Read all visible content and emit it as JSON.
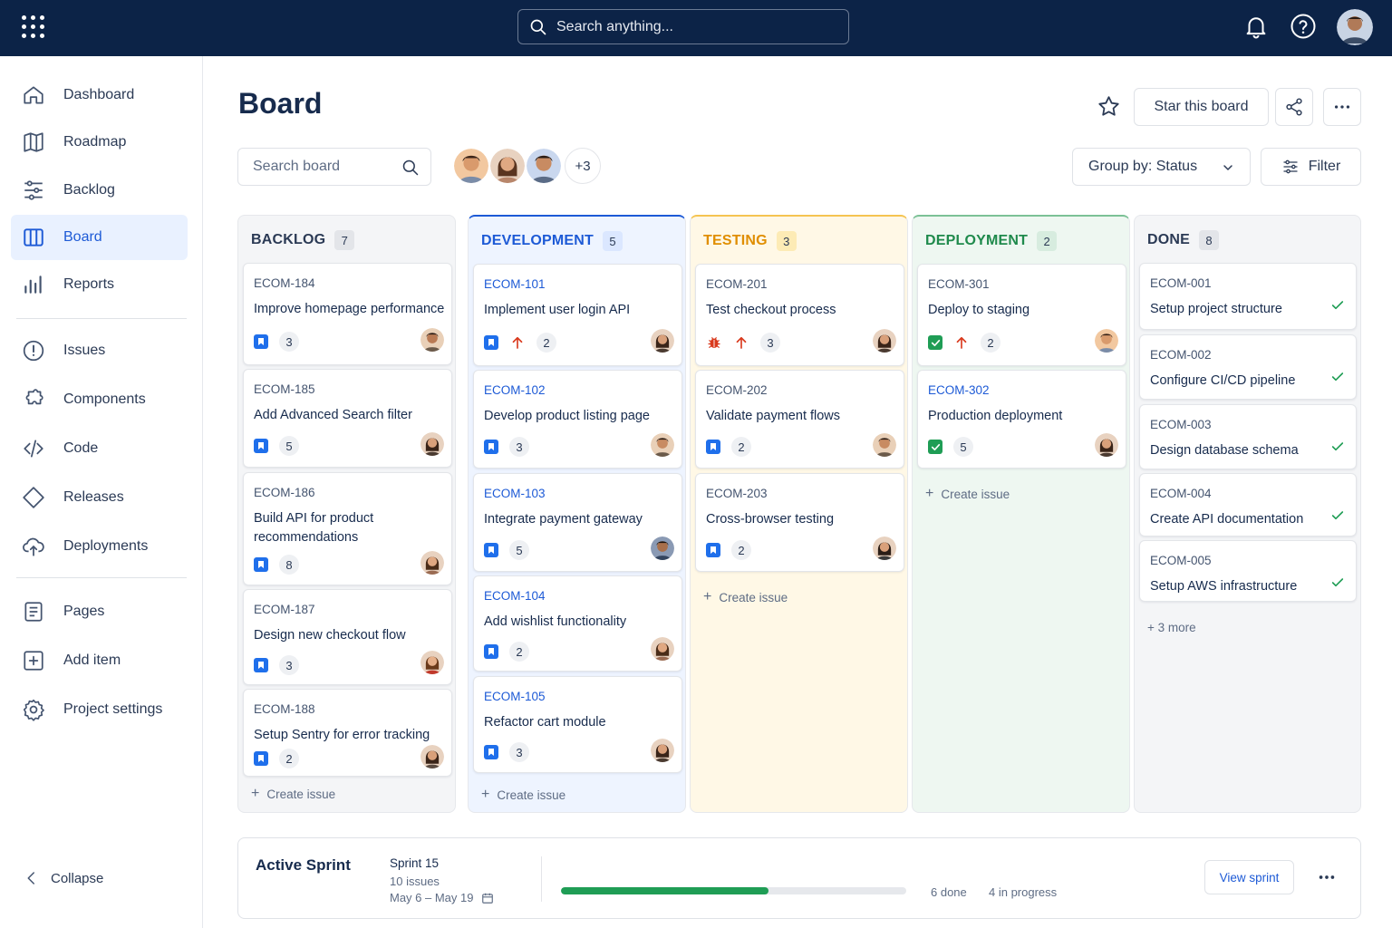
{
  "topbar": {
    "search_placeholder": "Search anything..."
  },
  "sidebar": {
    "items": [
      {
        "label": "Dashboard",
        "icon": "home-icon"
      },
      {
        "label": "Roadmap",
        "icon": "map-icon"
      },
      {
        "label": "Backlog",
        "icon": "backlog-icon"
      },
      {
        "label": "Board",
        "icon": "board-icon",
        "active": true
      },
      {
        "label": "Reports",
        "icon": "bar-chart-icon"
      },
      {
        "label": "Issues",
        "icon": "alert-circle-icon"
      },
      {
        "label": "Components",
        "icon": "puzzle-icon"
      },
      {
        "label": "Code",
        "icon": "code-icon"
      },
      {
        "label": "Releases",
        "icon": "tag-icon"
      },
      {
        "label": "Deployments",
        "icon": "cloud-upload-icon"
      },
      {
        "label": "Pages",
        "icon": "page-icon"
      },
      {
        "label": "Add item",
        "icon": "plus-square-icon"
      },
      {
        "label": "Project settings",
        "icon": "gear-icon"
      }
    ],
    "collapse_label": "Collapse"
  },
  "header": {
    "title": "Board",
    "star_label": "Star this board",
    "search_placeholder": "Search board",
    "member_overflow": "+3",
    "group_by_label": "Group by: Status",
    "filter_label": "Filter"
  },
  "columns": [
    {
      "title": "BACKLOG",
      "count": "7",
      "color": "#2b3a55",
      "bg": "#f4f5f7",
      "cards": [
        {
          "key": "ECOM-184",
          "title": "Improve homepage performance",
          "points": "3"
        },
        {
          "key": "ECOM-185",
          "title": "Add Advanced Search filter",
          "points": "5"
        },
        {
          "key": "ECOM-186",
          "title": "Build API for product recommendations",
          "points": "8"
        },
        {
          "key": "ECOM-187",
          "title": "Design new checkout flow",
          "points": "3"
        },
        {
          "key": "ECOM-188",
          "title": "Setup Sentry for error tracking",
          "points": "2"
        }
      ],
      "create_label": "Create issue"
    },
    {
      "title": "DEVELOPMENT",
      "count": "5",
      "color": "#1d5ad6",
      "bg": "#eef4ff",
      "cards": [
        {
          "key": "ECOM-101",
          "title": "Implement user login API",
          "points": "2"
        },
        {
          "key": "ECOM-102",
          "title": "Develop product listing page",
          "points": "3"
        },
        {
          "key": "ECOM-103",
          "title": "Integrate payment gateway",
          "points": "5"
        },
        {
          "key": "ECOM-104",
          "title": "Add wishlist functionality",
          "points": "2"
        },
        {
          "key": "ECOM-105",
          "title": "Refactor cart module",
          "points": "3"
        }
      ],
      "create_label": "Create issue"
    },
    {
      "title": "TESTING",
      "count": "3",
      "color": "#e08e00",
      "bg": "#fff8e6",
      "cards": [
        {
          "key": "ECOM-201",
          "title": "Test checkout process",
          "points": "3"
        },
        {
          "key": "ECOM-202",
          "title": "Validate payment flows",
          "points": "2"
        },
        {
          "key": "ECOM-203",
          "title": "Cross-browser testing",
          "points": "2"
        }
      ],
      "create_label": "Create issue"
    },
    {
      "title": "DEPLOYMENT",
      "count": "2",
      "color": "#1f8a4c",
      "bg": "#eef7f1",
      "cards": [
        {
          "key": "ECOM-301",
          "title": "Deploy to staging",
          "points": "2"
        },
        {
          "key": "ECOM-302",
          "title": "Production deployment",
          "points": "5"
        }
      ],
      "create_label": "Create issue"
    },
    {
      "title": "DONE",
      "count": "8",
      "color": "#2b3a55",
      "bg": "#f4f5f7",
      "cards": [
        {
          "key": "ECOM-001",
          "title": "Setup project structure"
        },
        {
          "key": "ECOM-002",
          "title": "Configure CI/CD pipeline"
        },
        {
          "key": "ECOM-003",
          "title": "Design database schema"
        },
        {
          "key": "ECOM-004",
          "title": "Create API documentation"
        },
        {
          "key": "ECOM-005",
          "title": "Setup AWS infrastructure"
        }
      ],
      "more_label": "+ 3 more"
    }
  ],
  "sprint": {
    "title": "Active Sprint",
    "name": "Sprint 15",
    "issues": "10 issues",
    "dates": "May 6 – May 19",
    "progress": 0.6,
    "done": "6 done",
    "in_progress": "4 in progress",
    "view_label": "View sprint"
  }
}
